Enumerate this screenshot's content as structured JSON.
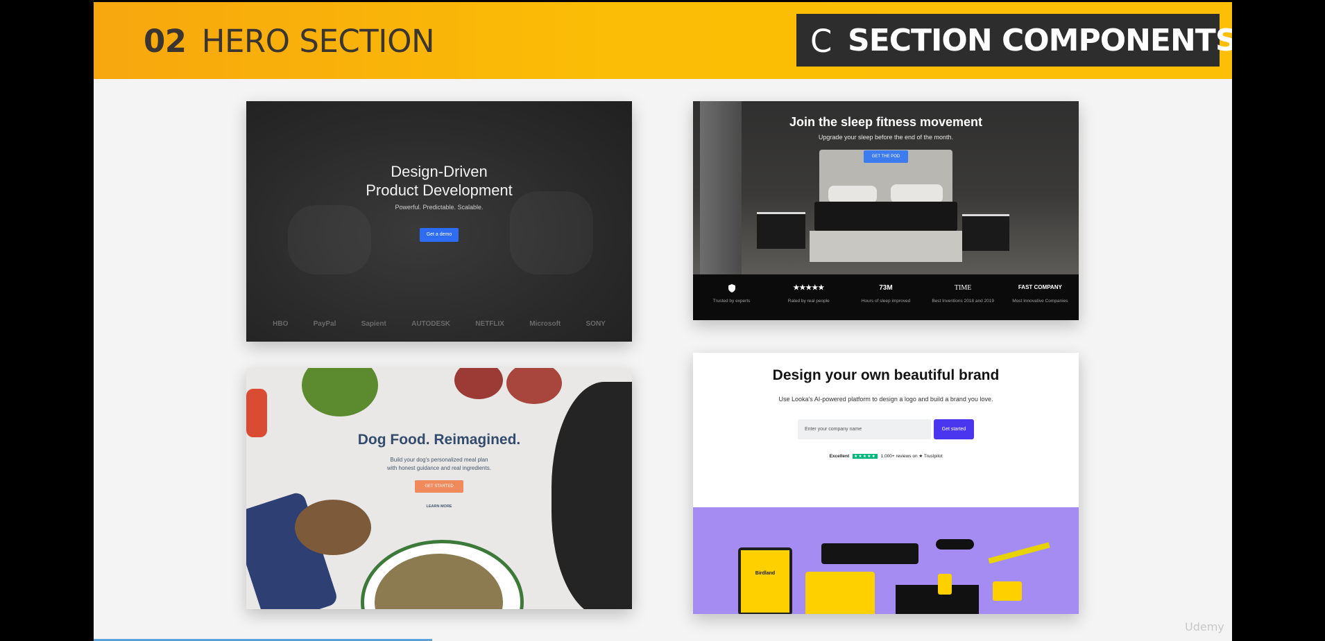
{
  "banner": {
    "number": "02",
    "title": "HERO SECTION",
    "badge_letter": "C",
    "badge_text": "SECTION COMPONENTS"
  },
  "card1": {
    "title_line1": "Design-Driven",
    "title_line2": "Product Development",
    "subtitle": "Powerful. Predictable. Scalable.",
    "button": "Get a demo",
    "logos": [
      "HBO",
      "PayPal",
      "Sapient",
      "AUTODESK",
      "NETFLIX",
      "Microsoft",
      "SONY"
    ]
  },
  "card2": {
    "title": "Join the sleep fitness movement",
    "subtitle": "Upgrade your sleep before the end of the month.",
    "button": "GET THE POD",
    "stats": [
      {
        "value": "",
        "icon": "shield-icon",
        "label": "Trusted by experts"
      },
      {
        "value": "★★★★★",
        "label": "Rated by real people"
      },
      {
        "value": "73M",
        "label": "Hours of sleep improved"
      },
      {
        "value": "TIME",
        "label": "Best Inventions 2018 and 2019"
      },
      {
        "value": "FAST COMPANY",
        "label": "Most Innovative Companies"
      }
    ]
  },
  "card3": {
    "title": "Dog Food. Reimagined.",
    "subtitle_line1": "Build your dog's personalized meal plan",
    "subtitle_line2": "with honest guidance and real ingredients.",
    "button": "GET STARTED",
    "link": "LEARN MORE"
  },
  "card4": {
    "title": "Design your own beautiful brand",
    "subtitle": "Use Looka's AI-powered platform to design a logo and build a brand you love.",
    "input_placeholder": "Enter your company name",
    "button": "Get started",
    "rating_label": "Excellent",
    "stars": "★★★★★",
    "reviews": "1,000+ reviews on",
    "trustpilot": "★ Trustpilot",
    "brand_name": "Birdland"
  },
  "watermark": "Udemy",
  "colors": {
    "banner": "#fbb907",
    "badge": "#2d2d2d",
    "card1_button": "#2f6cf4",
    "card3_title": "#344c6c",
    "card4_button": "#4b36f0",
    "card4_band": "#a58cf2"
  }
}
